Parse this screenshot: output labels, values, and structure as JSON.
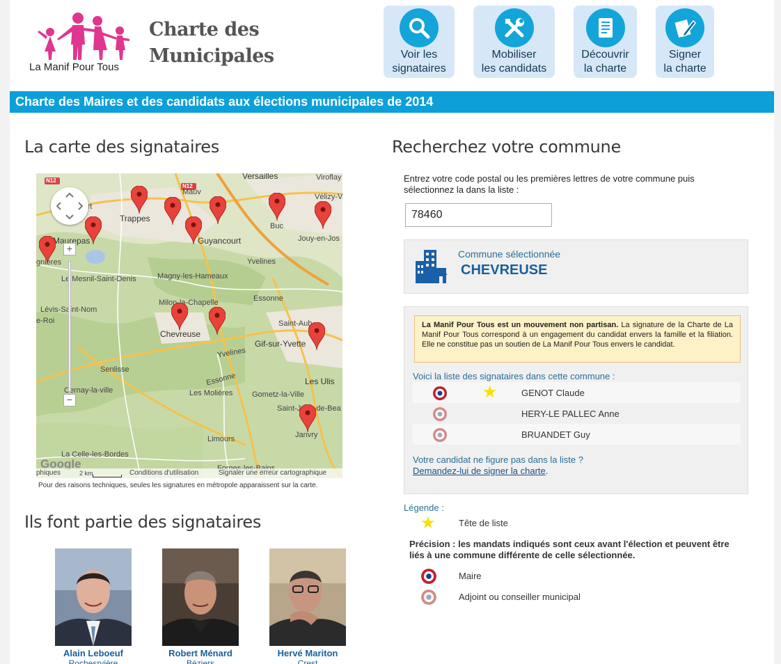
{
  "header": {
    "logo_text": "La Manif Pour Tous",
    "site_title_line1": "Charte des",
    "site_title_line2": "Municipales",
    "nav": [
      {
        "line1": "Voir les",
        "line2": "signataires",
        "icon": "search-icon"
      },
      {
        "line1": "Mobiliser",
        "line2": "les candidats",
        "icon": "tools-icon"
      },
      {
        "line1": "Découvrir",
        "line2": "la charte",
        "icon": "document-icon"
      },
      {
        "line1": "Signer",
        "line2": "la charte",
        "icon": "pen-icon"
      }
    ]
  },
  "banner": "Charte des Maires et des candidats aux élections municipales de 2014",
  "map_section": {
    "title": "La carte des signataires",
    "places": [
      "Versailles",
      "Viroflay",
      "Vélizy-V",
      "Trappes",
      "Guyancourt",
      "Buc",
      "Jouy-en-Jos",
      "Maurepas",
      "gnières",
      "Yvelines",
      "Magny-les-Hameaux",
      "Le Mesnil-Saint-Denis",
      "Lévis-Saint-Nom",
      "e-Roi",
      "Milon-la-Chapelle",
      "Essonne",
      "Chevreuse",
      "Saint-Aub",
      "Gif-sur-Yvette",
      "Yvelines",
      "Senlisse",
      "Cernay-la-ville",
      "Essonne",
      "Les Ulis",
      "Gometz-la-Ville",
      "Les Molières",
      "Saint-Jean-de-Bea",
      "Janvry",
      "Limours",
      "La Celle-les-Bordes",
      "Forges-les-Bains",
      "N12",
      "N12",
      "court",
      "Mauv"
    ],
    "footer": {
      "phiques": "phiques",
      "scale": "2 km",
      "terms": "Conditions d'utilisation",
      "report": "Signaler une erreur cartographique",
      "google": "Google"
    },
    "note": "Pour des raisons techniques, seules les signatures en métropole apparaissent sur la carte."
  },
  "signatories_section": {
    "title": "Ils font partie des signataires",
    "people": [
      {
        "name": "Alain Leboeuf",
        "city": "Rochesrvière"
      },
      {
        "name": "Robert Ménard",
        "city": "Béziers"
      },
      {
        "name": "Hervé Mariton",
        "city": "Crest"
      }
    ]
  },
  "search_section": {
    "title": "Recherchez votre commune",
    "intro": "Entrez votre code postal ou les premières lettres de votre commune puis sélectionnez la dans la liste :",
    "input_value": "78460",
    "selected_label": "Commune sélectionnée",
    "selected_name": "CHEVREUSE"
  },
  "list_box": {
    "notice_bold": "La Manif Pour Tous est un mouvement non partisan.",
    "notice_text": " La signature de la Charte de La Manif Pour Tous correspond à un engagement du candidat envers la famille et la filiation. Elle ne constitue pas un soutien de La Manif Pour Tous envers le candidat.",
    "list_title": "Voici la liste des signataires dans cette commune :",
    "signatories": [
      {
        "lastname": "GENOT",
        "firstname": "Claude",
        "role": "maire",
        "tete_de_liste": true
      },
      {
        "lastname": "HERY-LE PALLEC",
        "firstname": "Anne",
        "role": "adjoint",
        "tete_de_liste": false
      },
      {
        "lastname": "BRUANDET",
        "firstname": "Guy",
        "role": "adjoint",
        "tete_de_liste": false
      }
    ],
    "candidate_question": "Votre candidat ne figure pas dans la liste ?",
    "candidate_link": "Demandez-lui de signer la charte",
    "candidate_link_suffix": "."
  },
  "legend": {
    "title": "Légende :",
    "tete": "Tête de liste",
    "precision": "Précision : les mandats indiqués sont ceux avant l'élection et peuvent être liés à une commune différente de celle sélectionnée.",
    "maire": "Maire",
    "adjoint": "Adjoint ou conseiller municipal"
  },
  "colors": {
    "accent": "#0da0d8",
    "nav_bg": "#d6e7f8",
    "link": "#1a5f99",
    "pin": "#e8433b",
    "star": "#f5e100",
    "logo": "#e0368f"
  }
}
